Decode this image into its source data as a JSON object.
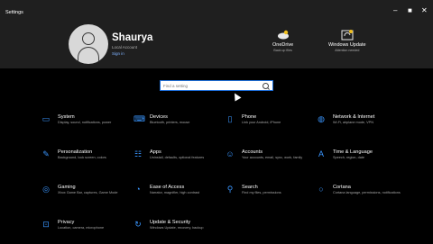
{
  "window": {
    "title": "Settings"
  },
  "user": {
    "name": "Shaurya",
    "account_type": "Local Account",
    "sign_in_link": "Sign in"
  },
  "quick_links": [
    {
      "title": "OneDrive",
      "subtitle": "Back up files",
      "icon": "onedrive-icon"
    },
    {
      "title": "Windows Update",
      "subtitle": "Attention needed",
      "icon": "windows-update-icon"
    }
  ],
  "search": {
    "placeholder": "Find a setting"
  },
  "categories": [
    {
      "name": "System",
      "desc": "Display, sound, notifications, power",
      "icon": "laptop-icon",
      "glyph": "▭"
    },
    {
      "name": "Devices",
      "desc": "Bluetooth, printers, mouse",
      "icon": "keyboard-icon",
      "glyph": "⌨"
    },
    {
      "name": "Phone",
      "desc": "Link your Android, iPhone",
      "icon": "phone-icon",
      "glyph": "▯"
    },
    {
      "name": "Network & Internet",
      "desc": "Wi-Fi, airplane mode, VPN",
      "icon": "globe-icon",
      "glyph": "◍"
    },
    {
      "name": "Personalization",
      "desc": "Background, lock screen, colors",
      "icon": "brush-icon",
      "glyph": "✎"
    },
    {
      "name": "Apps",
      "desc": "Uninstall, defaults, optional features",
      "icon": "apps-icon",
      "glyph": "☷"
    },
    {
      "name": "Accounts",
      "desc": "Your accounts, email, sync, work, family",
      "icon": "person-icon",
      "glyph": "☺"
    },
    {
      "name": "Time & Language",
      "desc": "Speech, region, date",
      "icon": "language-icon",
      "glyph": "A"
    },
    {
      "name": "Gaming",
      "desc": "Xbox Game Bar, captures, Game Mode",
      "icon": "xbox-icon",
      "glyph": "◎"
    },
    {
      "name": "Ease of Access",
      "desc": "Narrator, magnifier, high contrast",
      "icon": "accessibility-icon",
      "glyph": "◔"
    },
    {
      "name": "Search",
      "desc": "Find my files, permissions",
      "icon": "search-icon",
      "glyph": "⚲"
    },
    {
      "name": "Cortana",
      "desc": "Cortana language, permissions, notifications",
      "icon": "cortana-icon",
      "glyph": "○"
    },
    {
      "name": "Privacy",
      "desc": "Location, camera, microphone",
      "icon": "lock-icon",
      "glyph": "⊡"
    },
    {
      "name": "Update & Security",
      "desc": "Windows Update, recovery, backup",
      "icon": "update-icon",
      "glyph": "↻"
    }
  ],
  "colors": {
    "accent": "#3a96ff",
    "background": "#000000",
    "header": "#1f1f1f"
  }
}
